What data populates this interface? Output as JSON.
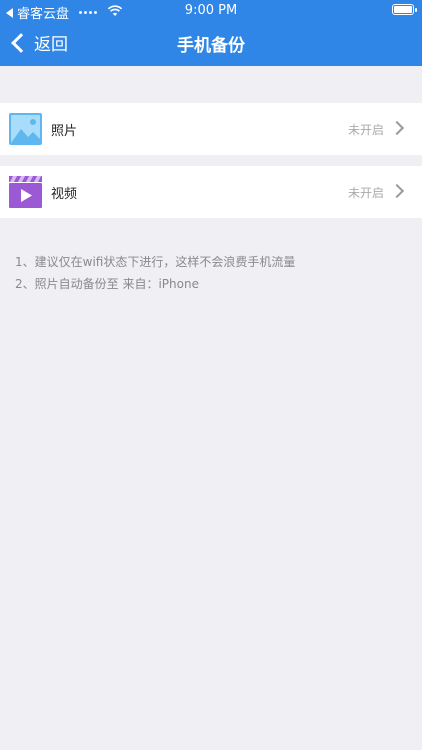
{
  "status_bar": {
    "carrier": "睿客云盘",
    "time": "9:00 PM"
  },
  "nav": {
    "back_label": "返回",
    "title": "手机备份"
  },
  "rows": [
    {
      "label": "照片",
      "status": "未开启",
      "icon": "photo-icon"
    },
    {
      "label": "视频",
      "status": "未开启",
      "icon": "video-icon"
    }
  ],
  "notes": [
    "1、建议仅在wifi状态下进行，这样不会浪费手机流量",
    "2、照片自动备份至  来自：iPhone"
  ],
  "colors": {
    "header": "#2f86e6",
    "background": "#efeff4",
    "photo_icon": "#5fb7f0",
    "video_icon": "#9b59d6"
  }
}
